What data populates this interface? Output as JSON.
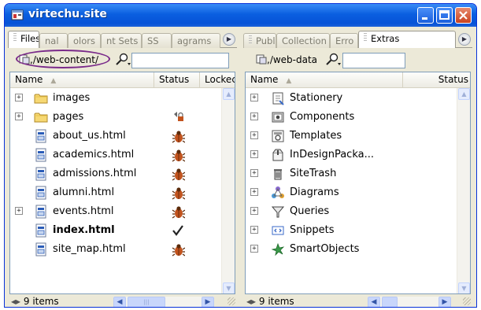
{
  "window": {
    "title": "virtechu.site"
  },
  "left": {
    "tabs": [
      "Files",
      "nal",
      "olors",
      "nt Sets",
      "SS",
      "agrams"
    ],
    "site": ",/web-content/",
    "columns": [
      "Name",
      "Status",
      "Lockec"
    ],
    "rows": [
      {
        "name": "images",
        "kind": "folder",
        "expander": "+",
        "status": "",
        "bold": false
      },
      {
        "name": "pages",
        "kind": "folder",
        "expander": "+",
        "status": "lock",
        "bold": false
      },
      {
        "name": "about_us.html",
        "kind": "html",
        "expander": "",
        "status": "bug",
        "bold": false
      },
      {
        "name": "academics.html",
        "kind": "html",
        "expander": "",
        "status": "bug",
        "bold": false
      },
      {
        "name": "admissions.html",
        "kind": "html",
        "expander": "",
        "status": "bug",
        "bold": false
      },
      {
        "name": "alumni.html",
        "kind": "html",
        "expander": "",
        "status": "bug",
        "bold": false
      },
      {
        "name": "events.html",
        "kind": "html",
        "expander": "+",
        "status": "bug",
        "bold": false
      },
      {
        "name": "index.html",
        "kind": "html",
        "expander": "",
        "status": "check",
        "bold": true
      },
      {
        "name": "site_map.html",
        "kind": "html",
        "expander": "",
        "status": "bug",
        "bold": false
      }
    ],
    "count": "9 items"
  },
  "right": {
    "tabs": [
      "Publi",
      "Collection",
      "Erro",
      "Extras"
    ],
    "site": ",/web-data",
    "columns": [
      "Name",
      "Status"
    ],
    "rows": [
      {
        "name": "Stationery",
        "icon": "stationery-icon",
        "expander": "+"
      },
      {
        "name": "Components",
        "icon": "components-icon",
        "expander": "+"
      },
      {
        "name": "Templates",
        "icon": "templates-icon",
        "expander": "+"
      },
      {
        "name": "InDesignPacka...",
        "icon": "indesign-package-icon",
        "expander": "+"
      },
      {
        "name": "SiteTrash",
        "icon": "trash-icon",
        "expander": "+"
      },
      {
        "name": "Diagrams",
        "icon": "diagrams-icon",
        "expander": "+"
      },
      {
        "name": "Queries",
        "icon": "queries-icon",
        "expander": "+"
      },
      {
        "name": "Snippets",
        "icon": "snippets-icon",
        "expander": "+"
      },
      {
        "name": "SmartObjects",
        "icon": "smartobjects-icon",
        "expander": "+"
      }
    ],
    "count": "9 items"
  },
  "colors": {
    "titlebar": "#0a5fe0",
    "chrome": "#ece9d8",
    "highlight_ring": "#7a2a8a"
  }
}
